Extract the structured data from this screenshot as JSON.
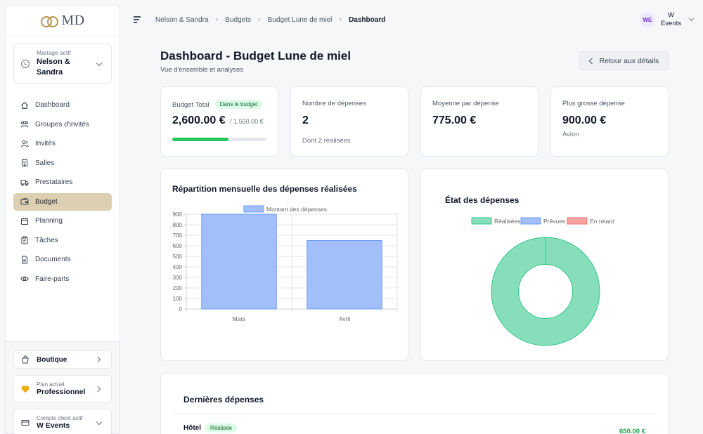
{
  "brand": {
    "text": "MD"
  },
  "sidebar": {
    "wedding": {
      "label": "Mariage actif",
      "value": "Nelson & Sandra"
    },
    "items": [
      {
        "label": "Dashboard",
        "icon": "home-icon"
      },
      {
        "label": "Groupes d'invités",
        "icon": "groups-icon"
      },
      {
        "label": "Invités",
        "icon": "users-icon"
      },
      {
        "label": "Salles",
        "icon": "building-icon"
      },
      {
        "label": "Prestataires",
        "icon": "truck-icon"
      },
      {
        "label": "Budget",
        "icon": "wallet-icon",
        "active": true
      },
      {
        "label": "Planning",
        "icon": "calendar-icon"
      },
      {
        "label": "Tâches",
        "icon": "clipboard-icon"
      },
      {
        "label": "Documents",
        "icon": "document-icon"
      },
      {
        "label": "Faire-parts",
        "icon": "eye-icon"
      }
    ],
    "shop": {
      "label": "Boutique"
    },
    "plan": {
      "label": "Plan actuel",
      "value": "Professionnel"
    },
    "account": {
      "label": "Compte client actif",
      "value": "W Events"
    }
  },
  "topbar": {
    "breadcrumb": [
      "Nelson & Sandra",
      "Budgets",
      "Budget Lune de miel",
      "Dashboard"
    ],
    "user": {
      "initials": "WE",
      "name_line1": "W",
      "name_line2": "Events"
    }
  },
  "header": {
    "title": "Dashboard - Budget Lune de miel",
    "subtitle": "Vue d'ensemble et analyses",
    "back_label": "Retour aux détails"
  },
  "kpis": {
    "budget": {
      "label": "Budget Total",
      "badge": "Dans le budget",
      "value": "2,600.00 €",
      "secondary": "/ 1,550.00 €",
      "progress": 0.596
    },
    "count": {
      "label": "Nombre de dépenses",
      "value": "2",
      "note": "Dont 2 réalisées"
    },
    "average": {
      "label": "Moyenne par dépense",
      "value": "775.00 €"
    },
    "largest": {
      "label": "Plus grosse dépense",
      "value": "900.00 €",
      "note": "Avion"
    }
  },
  "monthly_card": {
    "title": "Répartition mensuelle des dépenses réalisées"
  },
  "status_card": {
    "title": "État des dépenses"
  },
  "chart_data": [
    {
      "type": "bar",
      "legend": "Montant des dépenses",
      "categories": [
        "Mars",
        "Avril"
      ],
      "values": [
        900,
        650
      ],
      "ylim": [
        0,
        900
      ],
      "yticks": [
        0,
        100,
        200,
        300,
        400,
        500,
        600,
        700,
        800,
        900
      ],
      "color": "#a3bffa",
      "border": "#6b9cf5",
      "legend_position": "top",
      "grid": true
    },
    {
      "type": "pie",
      "donut": true,
      "labels": [
        "Réalisées",
        "Prévues",
        "En retard"
      ],
      "values": [
        2,
        0,
        0
      ],
      "colors": [
        "#86dfba",
        "#a3bffa",
        "#f8a5a5"
      ],
      "borders": [
        "#34c48b",
        "#6b9cf5",
        "#ef6b6b"
      ],
      "legend_position": "top"
    }
  ],
  "recent": {
    "title": "Dernières dépenses",
    "items": [
      {
        "name": "Hôtel",
        "status": "Réalisée",
        "amount": "650.00 €"
      }
    ]
  },
  "colors": {
    "accent": "#dccfb2",
    "success": "#22c55e",
    "brand_gold": "#b69553"
  }
}
